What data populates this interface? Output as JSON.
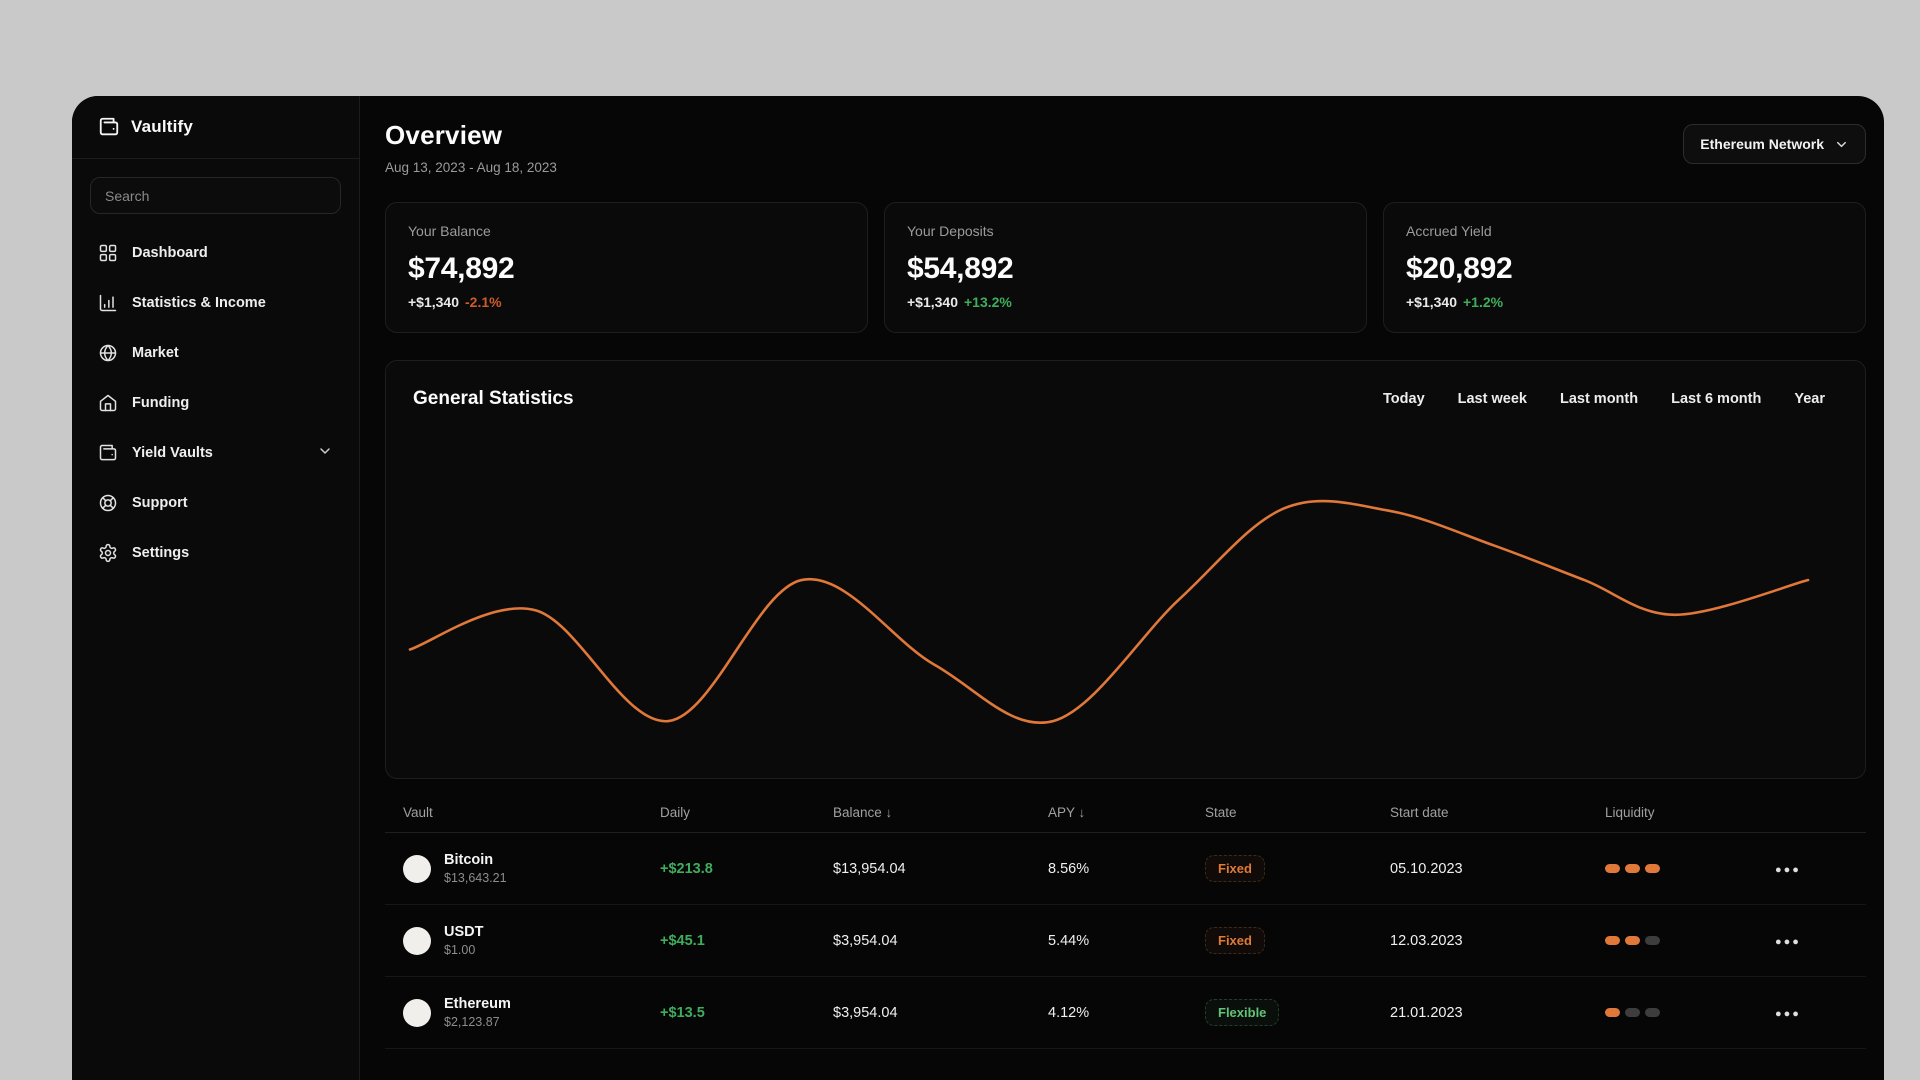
{
  "app": {
    "name": "Vaultify"
  },
  "colors": {
    "accent_orange": "#e0783a",
    "positive_green": "#3fae5c",
    "negative_orange": "#cd5b2b"
  },
  "sidebar": {
    "search_placeholder": "Search",
    "items": [
      {
        "label": "Dashboard",
        "icon": "dashboard-grid-icon"
      },
      {
        "label": "Statistics & Income",
        "icon": "bar-chart-icon"
      },
      {
        "label": "Market",
        "icon": "globe-icon"
      },
      {
        "label": "Funding",
        "icon": "home-icon"
      },
      {
        "label": "Yield Vaults",
        "icon": "wallet-icon",
        "expandable": true
      },
      {
        "label": "Support",
        "icon": "life-buoy-icon"
      },
      {
        "label": "Settings",
        "icon": "gear-icon"
      }
    ]
  },
  "header": {
    "title": "Overview",
    "date_range": "Aug 13, 2023 - Aug 18, 2023",
    "network_selector": "Ethereum Network"
  },
  "stat_cards": [
    {
      "label": "Your Balance",
      "value": "$74,892",
      "delta": "+$1,340",
      "pct": "-2.1%",
      "pct_color": "#cd5b2b"
    },
    {
      "label": "Your Deposits",
      "value": "$54,892",
      "delta": "+$1,340",
      "pct": "+13.2%",
      "pct_color": "#3fae5c"
    },
    {
      "label": "Accrued Yield",
      "value": "$20,892",
      "delta": "+$1,340",
      "pct": "+1.2%",
      "pct_color": "#3fae5c"
    }
  ],
  "statistics_panel": {
    "title": "General Statistics",
    "ranges": [
      "Today",
      "Last week",
      "Last month",
      "Last 6 month",
      "Year"
    ]
  },
  "chart_data": {
    "type": "line",
    "title": "General Statistics",
    "xlabel": "time (Aug 13, 2023 - Aug 18, 2023)",
    "ylabel": "relative value (axis unlabeled)",
    "grid": false,
    "legend": false,
    "line_color": "#e0783a",
    "points_pct": [
      [
        0,
        34
      ],
      [
        9,
        52
      ],
      [
        18.5,
        1
      ],
      [
        28,
        66
      ],
      [
        37.5,
        27
      ],
      [
        46,
        1
      ],
      [
        55,
        57
      ],
      [
        62.5,
        99
      ],
      [
        70,
        98
      ],
      [
        77.5,
        82
      ],
      [
        84,
        66
      ],
      [
        90.5,
        50
      ],
      [
        100,
        66
      ]
    ]
  },
  "table": {
    "columns": [
      {
        "label": "Vault"
      },
      {
        "label": "Daily"
      },
      {
        "label": "Balance",
        "sort": "desc"
      },
      {
        "label": "APY",
        "sort": "desc"
      },
      {
        "label": "State"
      },
      {
        "label": "Start date"
      },
      {
        "label": "Liquidity"
      }
    ],
    "sort_arrow": "↓",
    "rows": [
      {
        "name": "Bitcoin",
        "price": "$13,643.21",
        "daily": "+$213.8",
        "balance": "$13,954.04",
        "apy": "8.56%",
        "state": "Fixed",
        "start_date": "05.10.2023",
        "liquidity": 3
      },
      {
        "name": "USDT",
        "price": "$1.00",
        "daily": "+$45.1",
        "balance": "$3,954.04",
        "apy": "5.44%",
        "state": "Fixed",
        "start_date": "12.03.2023",
        "liquidity": 2
      },
      {
        "name": "Ethereum",
        "price": "$2,123.87",
        "daily": "+$13.5",
        "balance": "$3,954.04",
        "apy": "4.12%",
        "state": "Flexible",
        "start_date": "21.01.2023",
        "liquidity": 1
      }
    ],
    "liquidity_max": 3
  }
}
